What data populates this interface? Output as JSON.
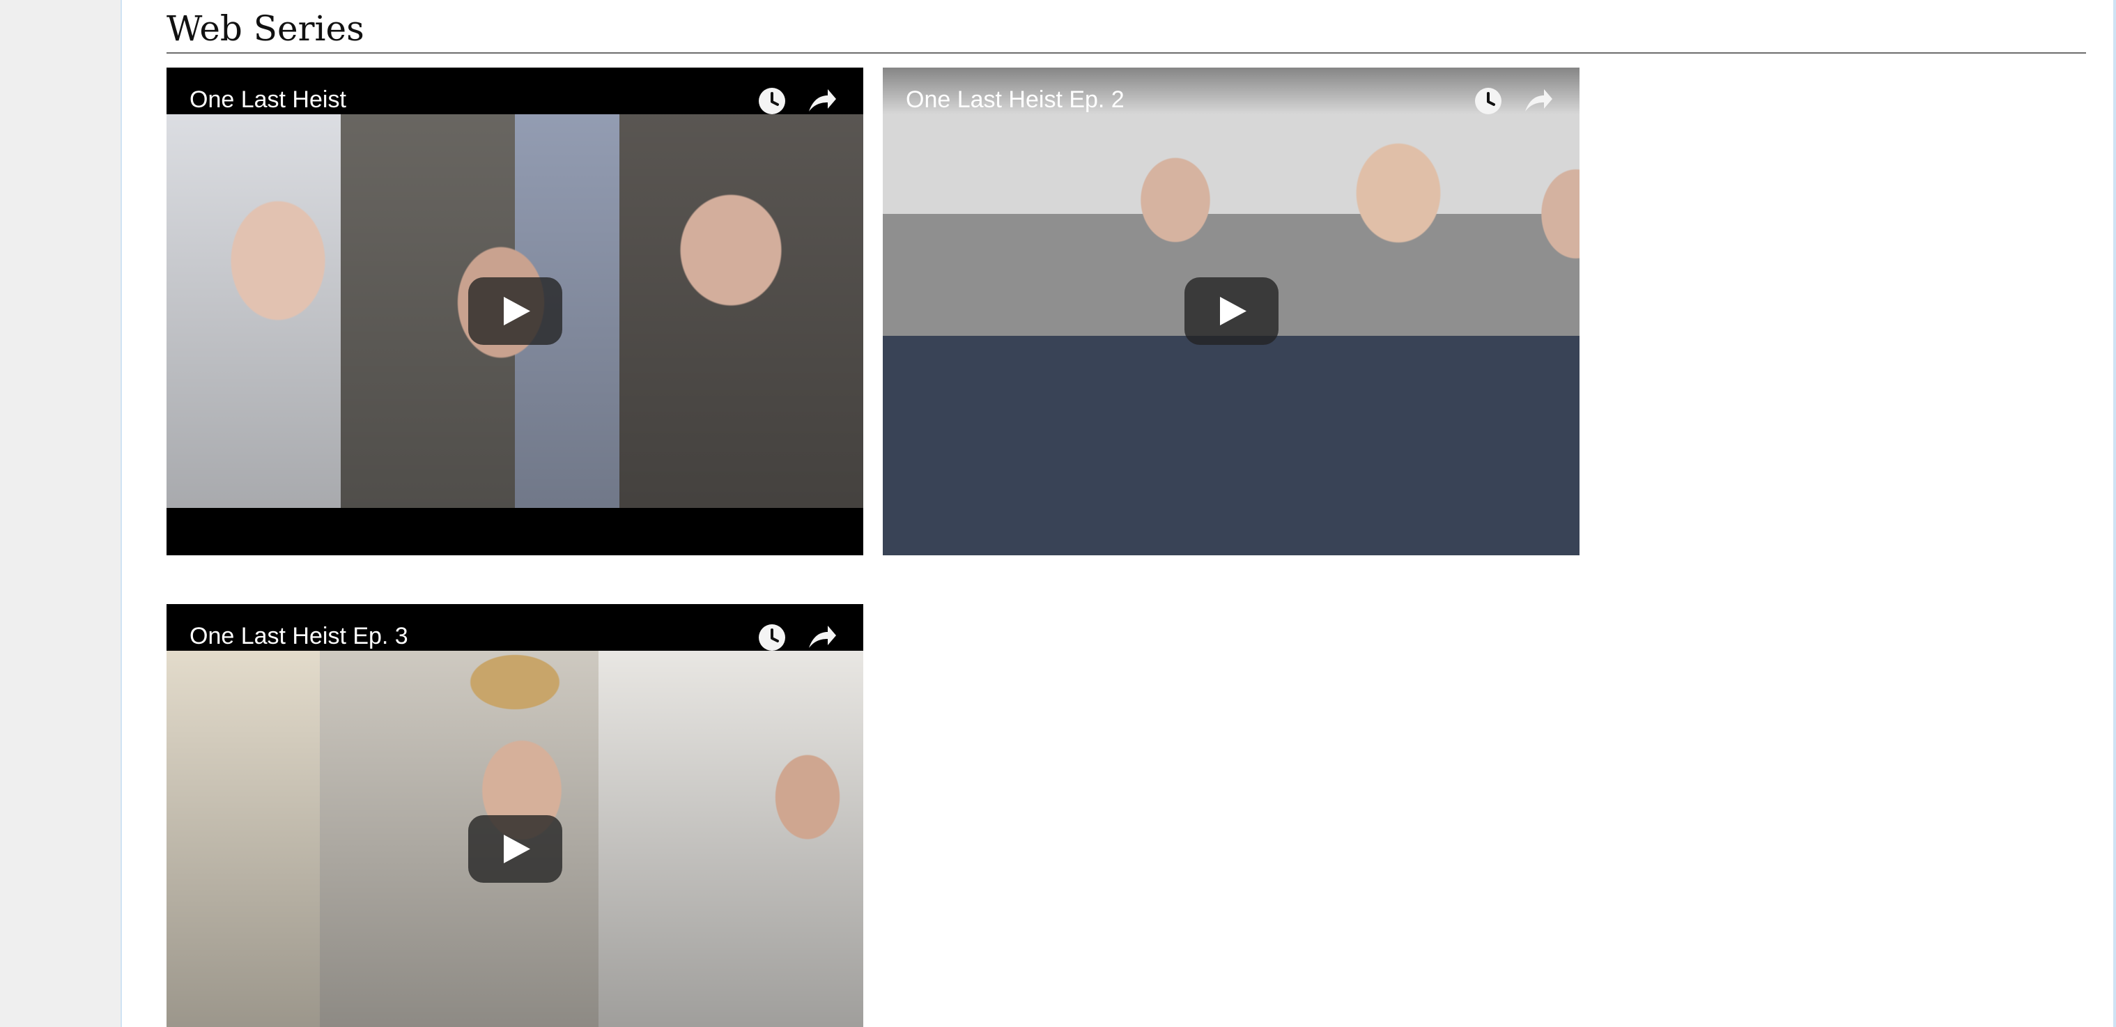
{
  "page": {
    "section_title": "Web Series"
  },
  "videos": [
    {
      "title": "One Last Heist",
      "icons": [
        "clock-icon",
        "share-icon",
        "play-icon"
      ]
    },
    {
      "title": "One Last Heist Ep. 2",
      "icons": [
        "clock-icon",
        "share-icon",
        "play-icon"
      ]
    },
    {
      "title": "One Last Heist Ep. 3",
      "icons": [
        "clock-icon",
        "share-icon",
        "play-icon"
      ]
    }
  ],
  "colors": {
    "rail": "#efefef",
    "title_text": "#111111",
    "video_overlay": "#000000",
    "overlay_text": "#ffffff"
  }
}
